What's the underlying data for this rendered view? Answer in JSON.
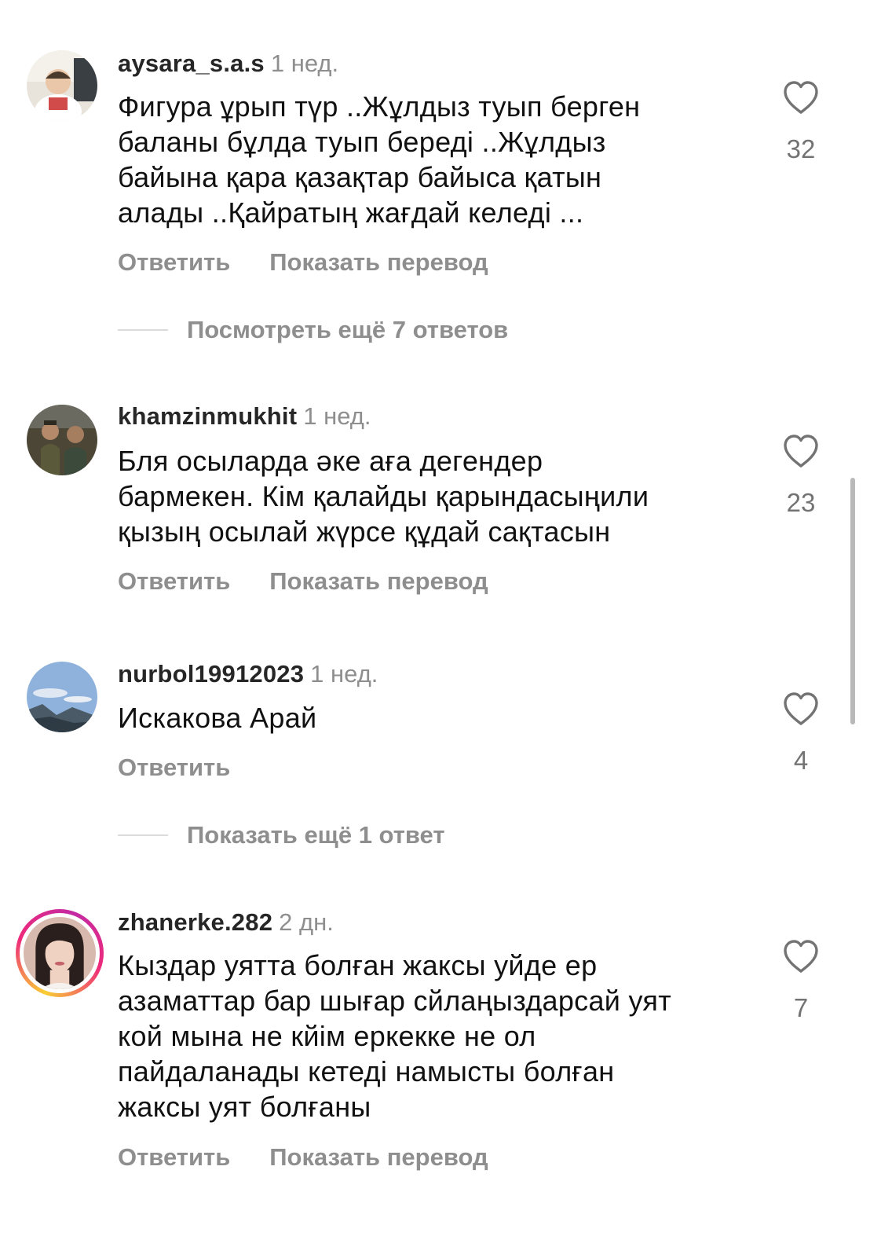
{
  "comments": [
    {
      "username": "aysara_s.a.s",
      "time": "1 нед.",
      "text_lines": [
        "Фигура ұрып түр ..Жұлдыз туып берген",
        "баланы бұлда туып береді ..Жұлдыз",
        "байына қара  қазақтар байыса қатын",
        "алады ..Қайратың жағдай келеді ..."
      ],
      "likes": "32",
      "reply_label": "Ответить",
      "translate_label": "Показать перевод",
      "more_replies": "Посмотреть ещё 7 ответов",
      "avatar_icon": "baby-photo-avatar"
    },
    {
      "username": "khamzinmukhit",
      "time": "1 нед.",
      "text_lines": [
        "Бля осыларда әке аға дегендер",
        "бармекен. Кім қалайды қарындасыңили",
        "қызың осылай жүрсе құдай сақтасын"
      ],
      "likes": "23",
      "reply_label": "Ответить",
      "translate_label": "Показать перевод",
      "avatar_icon": "two-men-photo-avatar"
    },
    {
      "username": "nurbol19912023",
      "time": "1 нед.",
      "text_lines": [
        "Искакова Арай"
      ],
      "likes": "4",
      "reply_label": "Ответить",
      "more_replies": "Показать ещё 1 ответ",
      "avatar_icon": "mountain-sky-avatar"
    },
    {
      "username": "zhanerke.282",
      "time": "2 дн.",
      "text_lines": [
        "Кыздар уятта болған жаксы уйде ер",
        "азаматтар бар шығар сйлаңыздарсай уят",
        "кой мына не кйім еркекке не ол",
        "пайдаланады кетеді намысты болған",
        "жаксы уят болғаны"
      ],
      "likes": "7",
      "reply_label": "Ответить",
      "translate_label": "Показать перевод",
      "avatar_icon": "woman-selfie-story-avatar"
    }
  ],
  "colors": {
    "username": "#262626",
    "secondary": "#8e8e8e",
    "like_count": "#737373",
    "divider": "#dbdbdb",
    "story_ring_start": "#f9ce34",
    "story_ring_mid": "#ee2a7b"
  }
}
